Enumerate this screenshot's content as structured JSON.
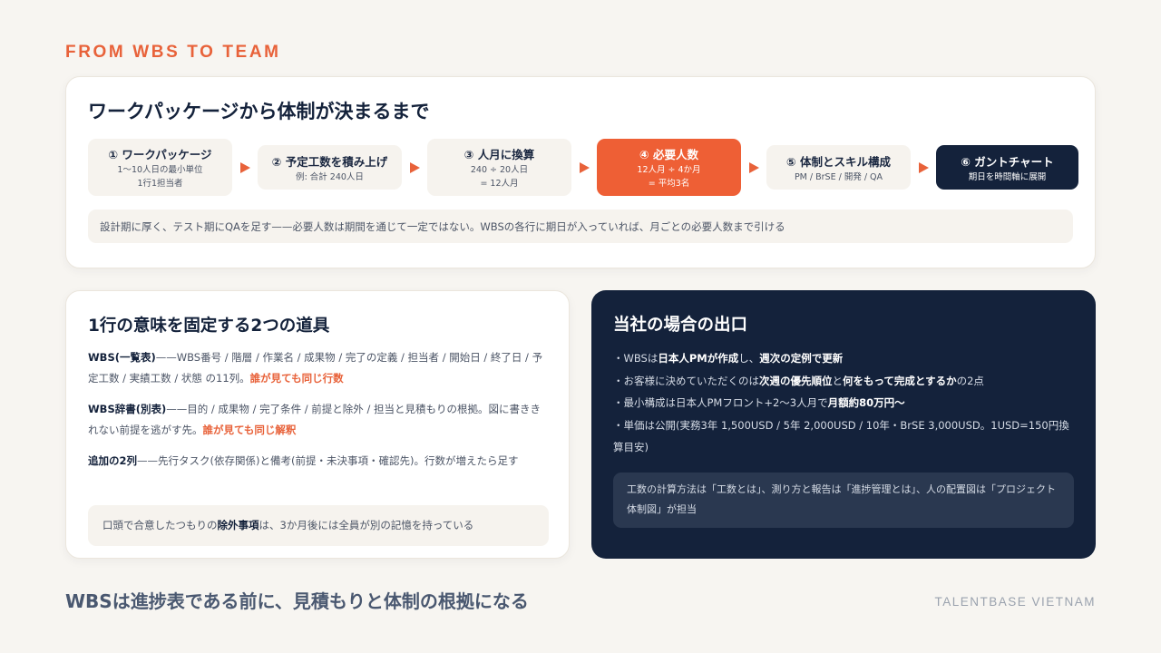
{
  "eyebrow": "FROM WBS TO TEAM",
  "top_card": {
    "title": "ワークパッケージから体制が決まるまで",
    "steps": [
      {
        "title": "① ワークパッケージ",
        "sub1": "1〜10人日の最小単位",
        "sub2": "1行1担当者"
      },
      {
        "title": "② 予定工数を積み上げ",
        "sub1": "例: 合計 240人日",
        "sub2": ""
      },
      {
        "title": "③ 人月に換算",
        "sub1": "240 ÷ 20人日",
        "sub2": "= 12人月"
      },
      {
        "title": "④ 必要人数",
        "sub1": "12人月 ÷ 4か月",
        "sub2": "= 平均3名"
      },
      {
        "title": "⑤ 体制とスキル構成",
        "sub1": "PM / BrSE / 開発 / QA",
        "sub2": ""
      },
      {
        "title": "⑥ ガントチャート",
        "sub1": "期日を時間軸に展開",
        "sub2": ""
      }
    ],
    "note": "設計期に厚く、テスト期にQAを足す——必要人数は期間を通じて一定ではない。WBSの各行に期日が入っていれば、月ごとの必要人数まで引ける"
  },
  "left_card": {
    "title": "1行の意味を固定する2つの道具",
    "p1": {
      "lead": "WBS(一覧表)",
      "body": "——WBS番号 / 階層 / 作業名 / 成果物 / 完了の定義 / 担当者 / 開始日 / 終了日 / 予定工数 / 実績工数 / 状態 の11列。",
      "hl": "誰が見ても同じ行数"
    },
    "p2": {
      "lead": "WBS辞書(別表)",
      "body": "——目的 / 成果物 / 完了条件 / 前提と除外 / 担当と見積もりの根拠。図に書ききれない前提を逃がす先。",
      "hl": "誰が見ても同じ解釈"
    },
    "p3": {
      "lead": "追加の2列",
      "body": "——先行タスク(依存関係)と備考(前提・未決事項・確認先)。行数が増えたら足す"
    },
    "note": {
      "pre": "口頭で合意したつもりの",
      "bold": "除外事項",
      "post": "は、3か月後には全員が別の記憶を持っている"
    }
  },
  "right_card": {
    "title": "当社の場合の出口",
    "b1": {
      "pre": "・WBSは",
      "bold1": "日本人PMが作成",
      "mid": "し、",
      "bold2": "週次の定例で更新"
    },
    "b2": {
      "pre": "・お客様に決めていただくのは",
      "bold1": "次週の優先順位",
      "mid": "と",
      "bold2": "何をもって完成とするか",
      "post": "の2点"
    },
    "b3": {
      "pre": "・最小構成は日本人PMフロント+2〜3人月で",
      "bold": "月額約80万円〜"
    },
    "b4": "・単価は公開(実務3年 1,500USD / 5年 2,000USD / 10年・BrSE 3,000USD。1USD=150円換算目安)",
    "note": "工数の計算方法は「工数とは」、測り方と報告は「進捗管理とは」、人の配置図は「プロジェクト体制図」が担当"
  },
  "footer": {
    "title": "WBSは進捗表である前に、見積もりと体制の根拠になる",
    "brand": "TALENTBASE VIETNAM"
  },
  "colors": {
    "accent": "#e8623a",
    "navy": "#14223b",
    "background": "#f7f5f1"
  }
}
